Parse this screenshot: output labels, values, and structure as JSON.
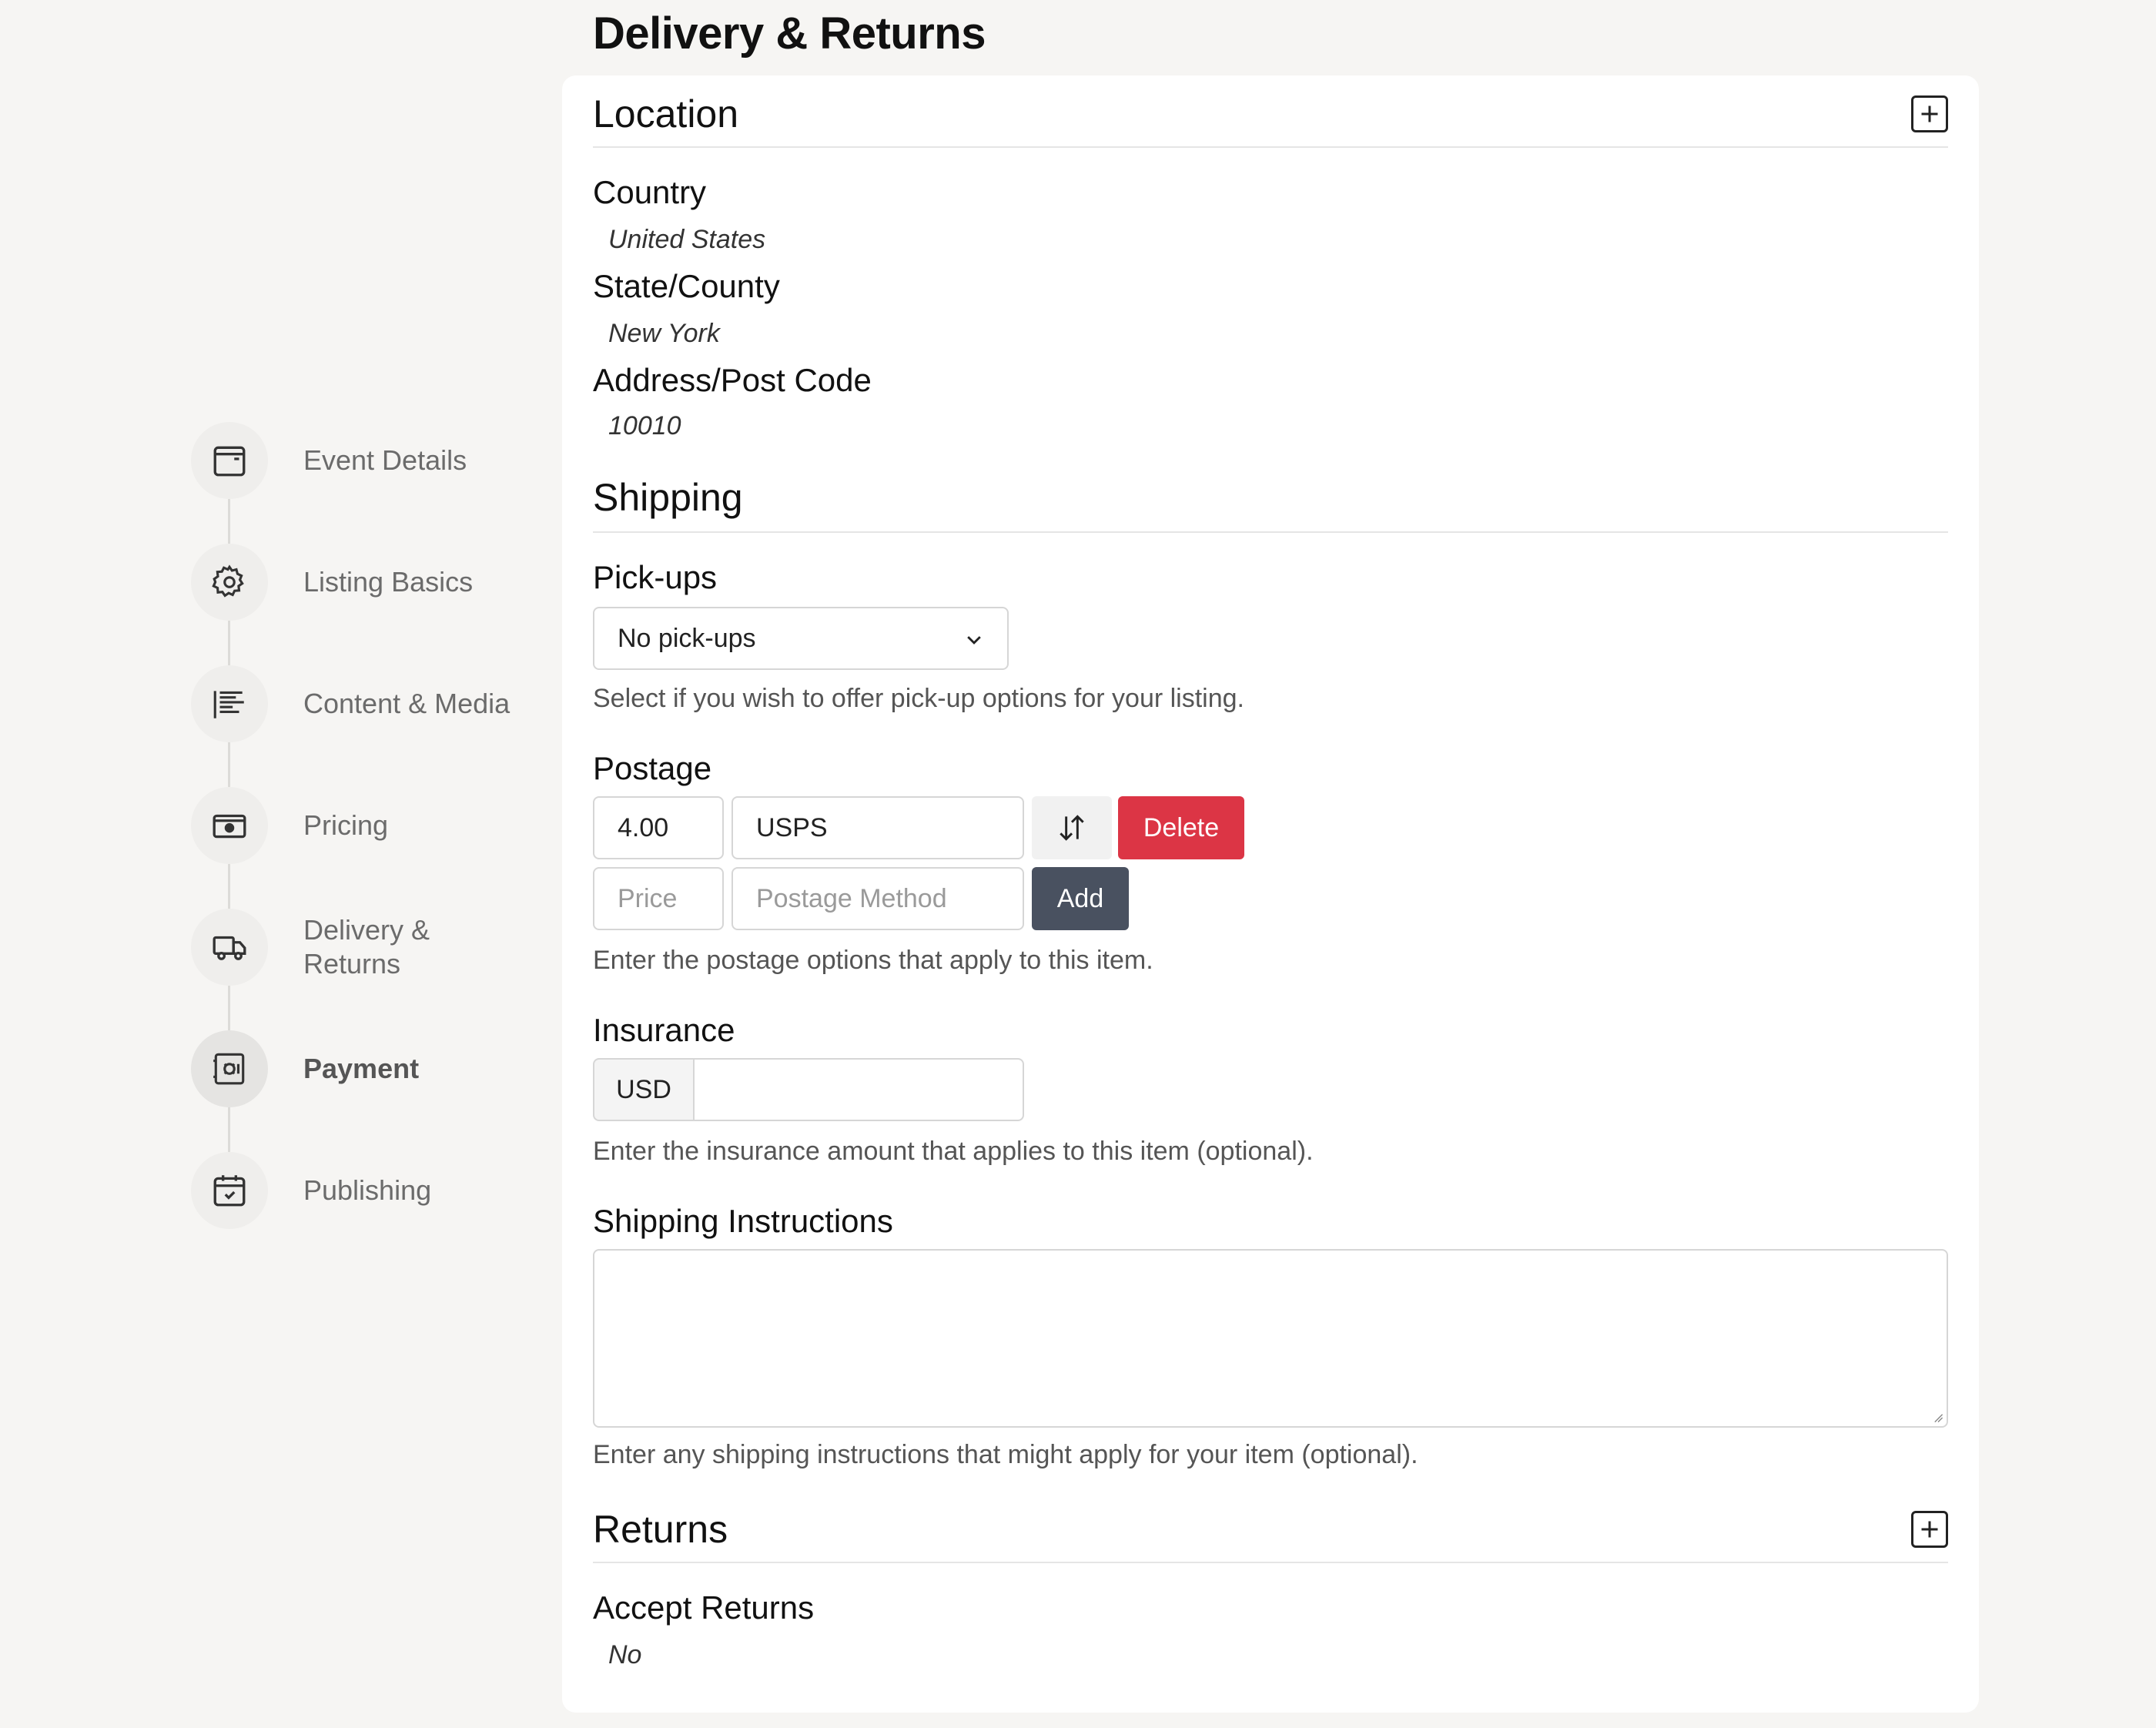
{
  "page": {
    "title": "Delivery & Returns"
  },
  "sidebar": {
    "steps": [
      {
        "label": "Event Details",
        "icon": "calendar-window-icon"
      },
      {
        "label": "Listing Basics",
        "icon": "gear-icon"
      },
      {
        "label": "Content & Media",
        "icon": "text-lines-icon"
      },
      {
        "label": "Pricing",
        "icon": "cash-icon"
      },
      {
        "label": "Delivery & Returns",
        "icon": "truck-icon"
      },
      {
        "label": "Payment",
        "icon": "safe-icon",
        "active": true
      },
      {
        "label": "Publishing",
        "icon": "calendar-check-icon"
      }
    ]
  },
  "location": {
    "title": "Location",
    "country_label": "Country",
    "country_value": "United States",
    "state_label": "State/County",
    "state_value": "New York",
    "address_label": "Address/Post Code",
    "address_value": "10010"
  },
  "shipping": {
    "title": "Shipping",
    "pickups": {
      "label": "Pick-ups",
      "selected": "No pick-ups",
      "help": "Select if you wish to offer pick-up options for your listing."
    },
    "postage": {
      "label": "Postage",
      "rows": [
        {
          "price": "4.00",
          "method": "USPS"
        }
      ],
      "delete_label": "Delete",
      "price_placeholder": "Price",
      "method_placeholder": "Postage Method",
      "add_label": "Add",
      "help": "Enter the postage options that apply to this item."
    },
    "insurance": {
      "label": "Insurance",
      "currency": "USD",
      "value": "",
      "help": "Enter the insurance amount that applies to this item (optional)."
    },
    "instructions": {
      "label": "Shipping Instructions",
      "value": "",
      "help": "Enter any shipping instructions that might apply for your item (optional)."
    }
  },
  "returns": {
    "title": "Returns",
    "accept_label": "Accept Returns",
    "accept_value": "No"
  },
  "colors": {
    "delete": "#dc3545",
    "add": "#495160",
    "background": "#f6f5f3"
  }
}
